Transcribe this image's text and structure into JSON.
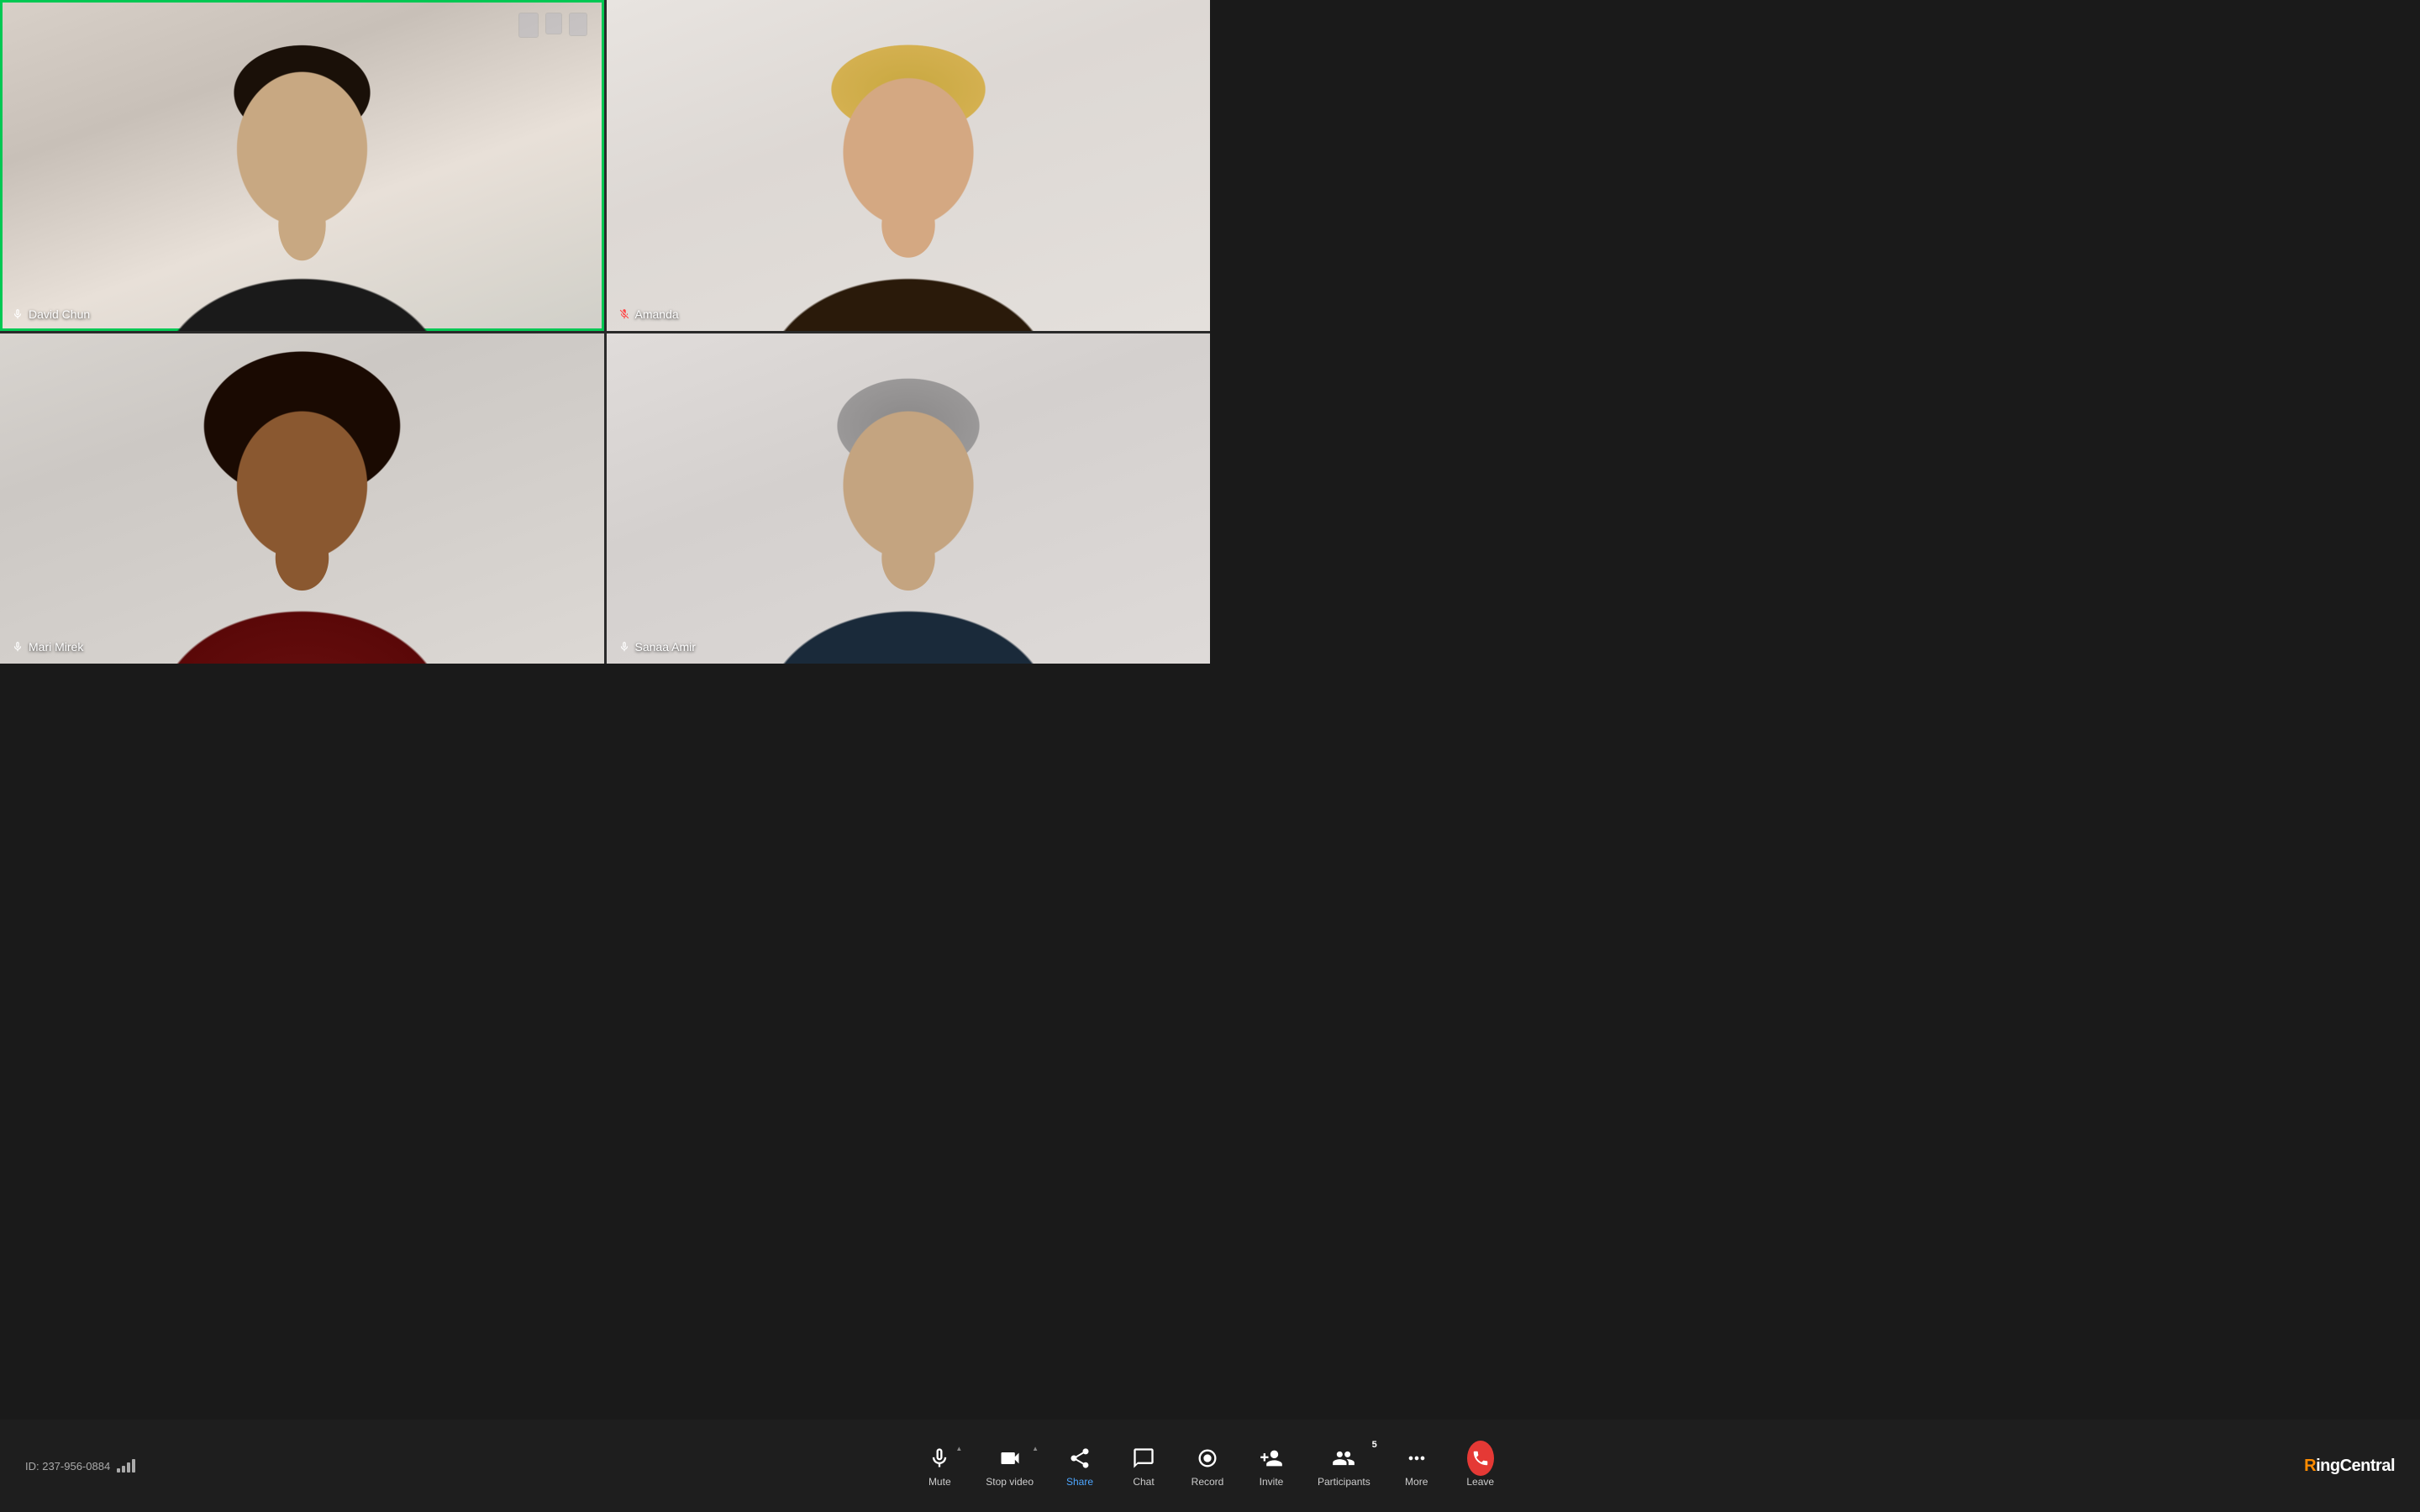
{
  "meeting": {
    "id": "ID: 237-956-0884",
    "participants": [
      {
        "id": "david-chun",
        "name": "David Chun",
        "micActive": true,
        "micMuted": false,
        "activeSpeaker": true,
        "tileClass": "tile-david"
      },
      {
        "id": "amanda",
        "name": "Amanda",
        "micActive": true,
        "micMuted": true,
        "activeSpeaker": false,
        "tileClass": "tile-amanda"
      },
      {
        "id": "mari-mirek",
        "name": "Mari Mirek",
        "micActive": true,
        "micMuted": false,
        "activeSpeaker": false,
        "tileClass": "tile-mari"
      },
      {
        "id": "sanaa-amir",
        "name": "Sanaa Amir",
        "micActive": true,
        "micMuted": false,
        "activeSpeaker": false,
        "tileClass": "tile-sanaa"
      }
    ]
  },
  "toolbar": {
    "meeting_id": "ID: 237-956-0884",
    "buttons": [
      {
        "id": "mute",
        "label": "Mute",
        "hasCaret": true
      },
      {
        "id": "stop-video",
        "label": "Stop video",
        "hasCaret": true
      },
      {
        "id": "share",
        "label": "Share",
        "hasCaret": false,
        "accent": true
      },
      {
        "id": "chat",
        "label": "Chat",
        "hasCaret": false
      },
      {
        "id": "record",
        "label": "Record",
        "hasCaret": false
      },
      {
        "id": "invite",
        "label": "Invite",
        "hasCaret": false
      },
      {
        "id": "participants",
        "label": "Participants",
        "hasCaret": false,
        "badge": "5"
      },
      {
        "id": "more",
        "label": "More",
        "hasCaret": false
      },
      {
        "id": "leave",
        "label": "Leave",
        "hasCaret": false
      }
    ]
  },
  "branding": {
    "logo_text_ring": "Ring",
    "logo_text_central": "Central"
  }
}
